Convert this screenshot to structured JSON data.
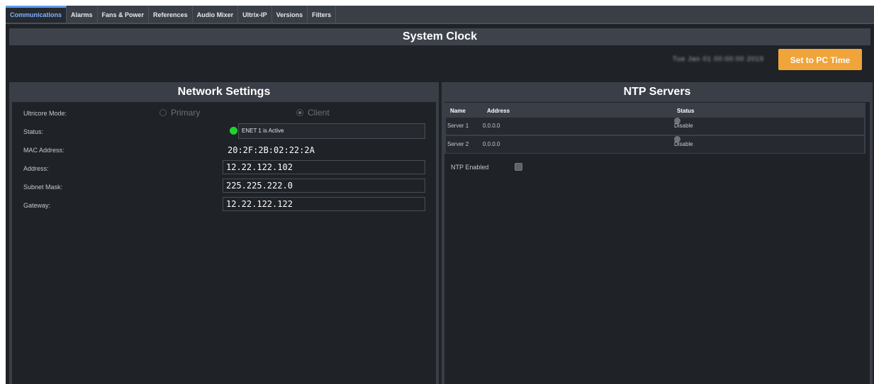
{
  "tabs": [
    {
      "label": "Communications",
      "active": true
    },
    {
      "label": "Alarms"
    },
    {
      "label": "Fans & Power"
    },
    {
      "label": "References"
    },
    {
      "label": "Audio Mixer"
    },
    {
      "label": "Ultrix-IP"
    },
    {
      "label": "Versions"
    },
    {
      "label": "Filters"
    }
  ],
  "system_clock": {
    "title": "System Clock",
    "time_text": "Tue Jan 01 00:00:00 2019",
    "set_button": "Set to PC Time"
  },
  "network": {
    "title": "Network Settings",
    "mode_label": "Ultricore Mode:",
    "mode_options": [
      "Primary",
      "Client"
    ],
    "mode_selected": "Client",
    "status_label": "Status:",
    "status_value": "ENET 1 is Active",
    "mac_label": "MAC Address:",
    "mac_value": "20:2F:2B:02:22:2A",
    "address_label": "Address:",
    "address_value": "12.22.122.102",
    "subnet_label": "Subnet Mask:",
    "subnet_value": "225.225.222.0",
    "gateway_label": "Gateway:",
    "gateway_value": "12.22.122.122"
  },
  "ntp": {
    "title": "NTP Servers",
    "columns": [
      "Name",
      "Address",
      "Status"
    ],
    "rows": [
      {
        "name": "Server 1",
        "address": "0.0.0.0",
        "status": "Disable"
      },
      {
        "name": "Server 2",
        "address": "0.0.0.0",
        "status": "Disable"
      }
    ],
    "enabled_label": "NTP Enabled"
  },
  "colors": {
    "accent": "#5d9cec",
    "button": "#f0a43a",
    "active_led": "#1fd42a",
    "inactive_led": "#6e737a"
  }
}
